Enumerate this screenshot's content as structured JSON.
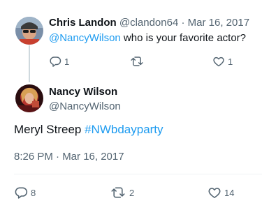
{
  "reply_tweet": {
    "author_name": "Chris Landon",
    "author_handle": "@clandon64",
    "separator": "·",
    "date": "Mar 16, 2017",
    "mention": "@NancyWilson",
    "text": " who is your favorite actor?",
    "actions": {
      "reply_icon": "comment-icon",
      "reply_count": "1",
      "retweet_icon": "retweet-icon",
      "retweet_count": "",
      "like_icon": "heart-icon",
      "like_count": "1"
    }
  },
  "main_tweet": {
    "author_name": "Nancy Wilson",
    "author_handle": "@NancyWilson",
    "text": "Meryl Streep ",
    "hashtag": "#NWbdayparty",
    "timestamp": "8:26 PM · Mar 16, 2017",
    "actions": {
      "reply_icon": "comment-icon",
      "reply_count": "8",
      "retweet_icon": "retweet-icon",
      "retweet_count": "2",
      "like_icon": "heart-icon",
      "like_count": "14"
    }
  },
  "colors": {
    "link": "#1d9bf0",
    "secondary_text": "#536471",
    "primary_text": "#0f1419",
    "thread_line": "#cfd9de"
  }
}
